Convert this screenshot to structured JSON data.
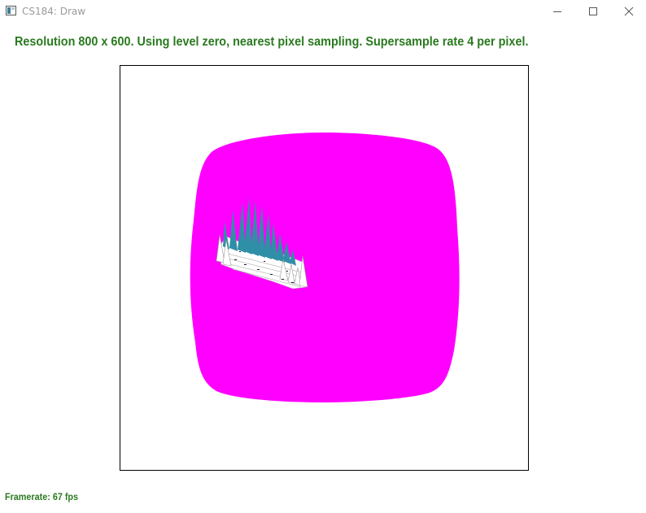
{
  "window": {
    "title": "CS184: Draw"
  },
  "status": {
    "text": "Resolution 800 x 600. Using level zero, nearest pixel sampling. Supersample rate 4 per pixel."
  },
  "framerate": {
    "text": "Framerate: 67 fps"
  },
  "colors": {
    "status_text": "#2a7a1f",
    "shape_fill": "#ff00ff",
    "texture_teal": "#2f8fa6",
    "canvas_border": "#000000"
  },
  "icons": {
    "app": "app-window-icon",
    "minimize": "minimize-icon",
    "maximize": "maximize-icon",
    "close": "close-icon"
  }
}
